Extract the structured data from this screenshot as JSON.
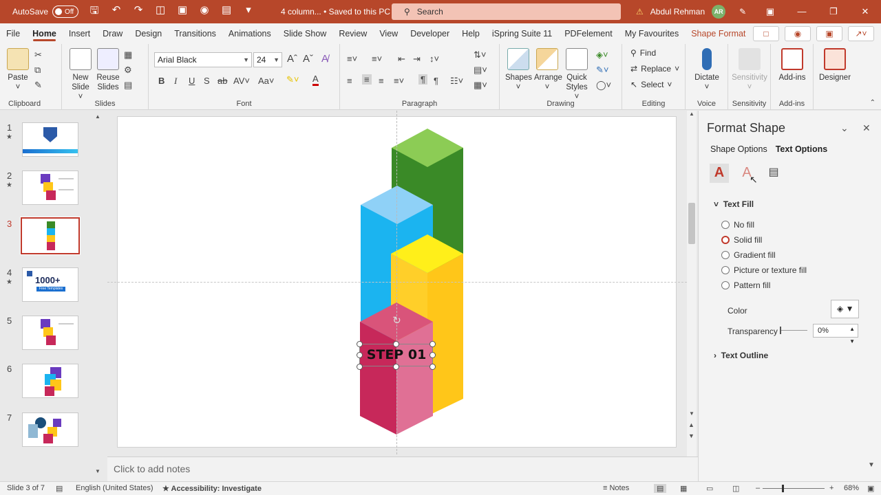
{
  "titlebar": {
    "autosave_label": "AutoSave",
    "autosave_state": "Off",
    "doc_title": "4 column... • Saved to this PC",
    "search_placeholder": "Search",
    "user_name": "Abdul Rehman",
    "user_initials": "AR"
  },
  "tabs": [
    "File",
    "Home",
    "Insert",
    "Draw",
    "Design",
    "Transitions",
    "Animations",
    "Slide Show",
    "Review",
    "View",
    "Developer",
    "Help",
    "iSpring Suite 11",
    "PDFelement",
    "My Favourites",
    "Shape Format"
  ],
  "active_tab": "Home",
  "ribbon": {
    "clipboard": {
      "paste": "Paste",
      "label": "Clipboard"
    },
    "slides": {
      "new_slide": "New",
      "new_slide2": "Slide",
      "reuse": "Reuse",
      "reuse2": "Slides",
      "label": "Slides"
    },
    "font": {
      "family": "Arial Black",
      "size": "24",
      "label": "Font"
    },
    "paragraph": {
      "label": "Paragraph"
    },
    "drawing": {
      "shapes": "Shapes",
      "arrange": "Arrange",
      "quick_styles": "Quick",
      "quick_styles2": "Styles",
      "label": "Drawing"
    },
    "editing": {
      "find": "Find",
      "replace": "Replace",
      "select": "Select",
      "label": "Editing"
    },
    "voice": {
      "dictate": "Dictate",
      "label": "Voice"
    },
    "sensitivity": {
      "btn": "Sensitivity",
      "label": "Sensitivity"
    },
    "addins": {
      "btn": "Add-ins",
      "label": "Add-ins"
    },
    "designer": {
      "btn": "Designer"
    }
  },
  "slides": [
    {
      "num": "1",
      "star": true
    },
    {
      "num": "2",
      "star": true
    },
    {
      "num": "3",
      "star": false
    },
    {
      "num": "4",
      "star": true
    },
    {
      "num": "5",
      "star": false
    },
    {
      "num": "6",
      "star": false
    },
    {
      "num": "7",
      "star": false
    }
  ],
  "thumb_texts": {
    "s4_big": "1000+",
    "s4_small": "Free Templates"
  },
  "slide_text": {
    "step": "STEP 01"
  },
  "notes_placeholder": "Click to add notes",
  "format_pane": {
    "title": "Format Shape",
    "tab_shape": "Shape Options",
    "tab_text": "Text Options",
    "section_fill": "Text Fill",
    "options": [
      "No fill",
      "Solid fill",
      "Gradient fill",
      "Picture or texture fill",
      "Pattern fill"
    ],
    "selected_option": "Solid fill",
    "color_label": "Color",
    "transparency_label": "Transparency",
    "transparency_value": "0%",
    "section_outline": "Text Outline"
  },
  "statusbar": {
    "slide_info": "Slide 3 of 7",
    "language": "English (United States)",
    "accessibility": "Accessibility: Investigate",
    "notes": "Notes",
    "zoom": "68%"
  },
  "colors": {
    "accent": "#b7472a",
    "green_top": "#8ccc55",
    "green_side": "#3a8a27",
    "blue_top": "#8fd1f7",
    "blue_side": "#1bb4f0",
    "yellow_top": "#ffef1a",
    "yellow_side": "#ffc619",
    "pink_top": "#d9547a",
    "pink_left": "#c7285a",
    "pink_right": "#e07095"
  }
}
